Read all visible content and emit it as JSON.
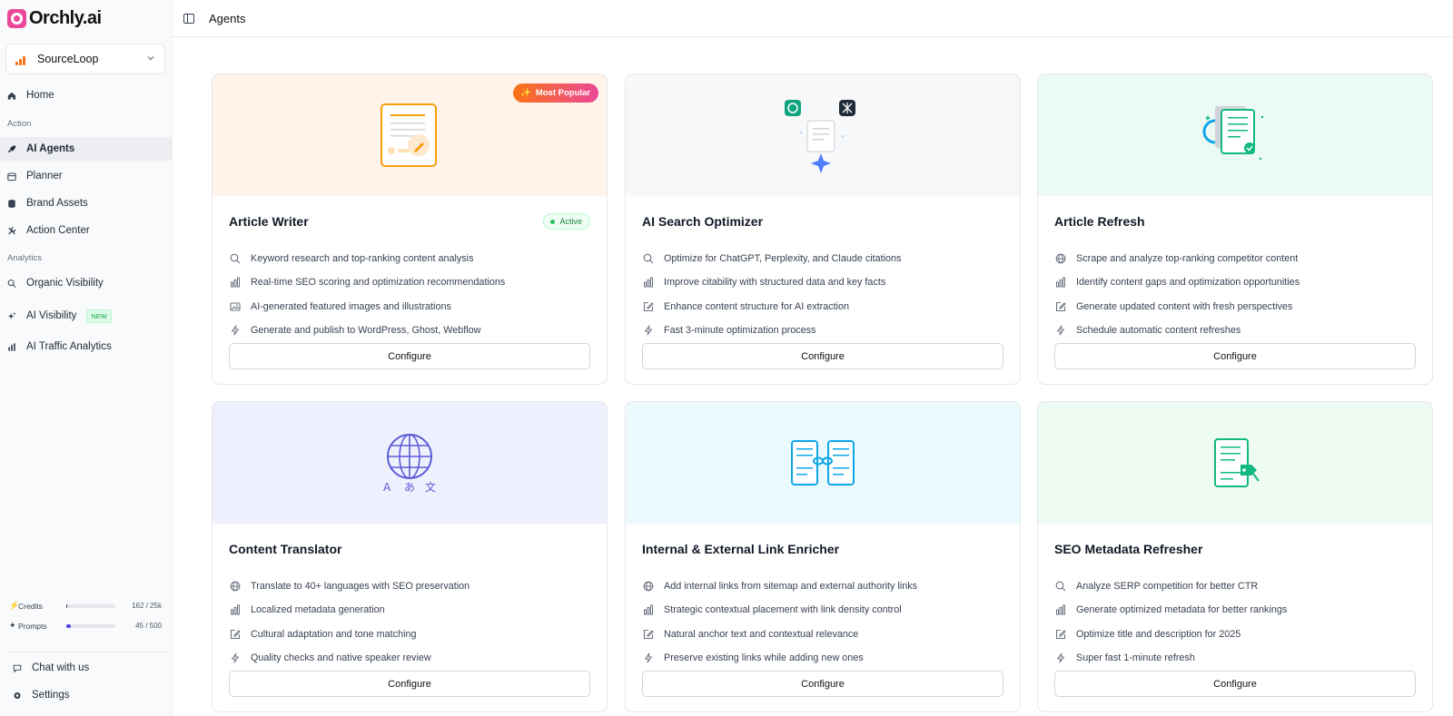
{
  "app": {
    "name": "Orchly.ai"
  },
  "workspace": {
    "name": "SourceLoop"
  },
  "header": {
    "title": "Agents"
  },
  "sidebar": {
    "home": "Home",
    "section_action": "Action",
    "action_items": [
      {
        "label": "AI Agents",
        "icon": "rocket-icon",
        "active": true
      },
      {
        "label": "Planner",
        "icon": "calendar-icon"
      },
      {
        "label": "Brand Assets",
        "icon": "database-icon"
      },
      {
        "label": "Action Center",
        "icon": "tools-icon"
      }
    ],
    "section_analytics": "Analytics",
    "analytics_items": [
      {
        "label": "Organic Visibility",
        "icon": "search-icon"
      },
      {
        "label": "AI Visibility",
        "icon": "sparkles-icon",
        "badge": "NEW"
      },
      {
        "label": "AI Traffic Analytics",
        "icon": "bar-chart-icon"
      }
    ],
    "usage": [
      {
        "label": "Credits",
        "value": "162 / 25k",
        "fraction": 0.0065,
        "color": "#374151"
      },
      {
        "label": "Prompts",
        "value": "45 / 500",
        "fraction": 0.09,
        "color": "#4f46e5"
      }
    ],
    "chat": "Chat with us",
    "settings": "Settings"
  },
  "cards": [
    {
      "title": "Article Writer",
      "hero_color": "#fff3ea",
      "badge_popular": "Most Popular",
      "badge_active": "Active",
      "features": [
        {
          "icon": "search-icon",
          "text": "Keyword research and top-ranking content analysis"
        },
        {
          "icon": "bar-chart-icon",
          "text": "Real-time SEO scoring and optimization recommendations"
        },
        {
          "icon": "image-icon",
          "text": "AI-generated featured images and illustrations"
        },
        {
          "icon": "lightning-icon",
          "text": "Generate and publish to WordPress, Ghost, Webflow"
        }
      ],
      "button": "Configure"
    },
    {
      "title": "AI Search Optimizer",
      "hero_color": "#f7f8fa",
      "features": [
        {
          "icon": "search-icon",
          "text": "Optimize for ChatGPT, Perplexity, and Claude citations"
        },
        {
          "icon": "bar-chart-icon",
          "text": "Improve citability with structured data and key facts"
        },
        {
          "icon": "edit-icon",
          "text": "Enhance content structure for AI extraction"
        },
        {
          "icon": "lightning-icon",
          "text": "Fast 3-minute optimization process"
        }
      ],
      "button": "Configure"
    },
    {
      "title": "Article Refresh",
      "hero_color": "#ebfaf3",
      "features": [
        {
          "icon": "globe-icon",
          "text": "Scrape and analyze top-ranking competitor content"
        },
        {
          "icon": "bar-chart-icon",
          "text": "Identify content gaps and optimization opportunities"
        },
        {
          "icon": "edit-icon",
          "text": "Generate updated content with fresh perspectives"
        },
        {
          "icon": "lightning-icon",
          "text": "Schedule automatic content refreshes"
        }
      ],
      "button": "Configure"
    },
    {
      "title": "Content Translator",
      "hero_color": "#eef1fd",
      "features": [
        {
          "icon": "globe-icon",
          "text": "Translate to 40+ languages with SEO preservation"
        },
        {
          "icon": "bar-chart-icon",
          "text": "Localized metadata generation"
        },
        {
          "icon": "edit-icon",
          "text": "Cultural adaptation and tone matching"
        },
        {
          "icon": "lightning-icon",
          "text": "Quality checks and native speaker review"
        }
      ],
      "button": "Configure"
    },
    {
      "title": "Internal & External Link Enricher",
      "hero_color": "#ebfbfd",
      "features": [
        {
          "icon": "globe-icon",
          "text": "Add internal links from sitemap and external authority links"
        },
        {
          "icon": "bar-chart-icon",
          "text": "Strategic contextual placement with link density control"
        },
        {
          "icon": "edit-icon",
          "text": "Natural anchor text and contextual relevance"
        },
        {
          "icon": "lightning-icon",
          "text": "Preserve existing links while adding new ones"
        }
      ],
      "button": "Configure"
    },
    {
      "title": "SEO Metadata Refresher",
      "hero_color": "#eefbf2",
      "features": [
        {
          "icon": "search-icon",
          "text": "Analyze SERP competition for better CTR"
        },
        {
          "icon": "bar-chart-icon",
          "text": "Generate optimized metadata for better rankings"
        },
        {
          "icon": "edit-icon",
          "text": "Optimize title and description for 2025"
        },
        {
          "icon": "lightning-icon",
          "text": "Super fast 1-minute refresh"
        }
      ],
      "button": "Configure"
    }
  ],
  "translator_glyphs": [
    "A",
    "あ",
    "文"
  ]
}
